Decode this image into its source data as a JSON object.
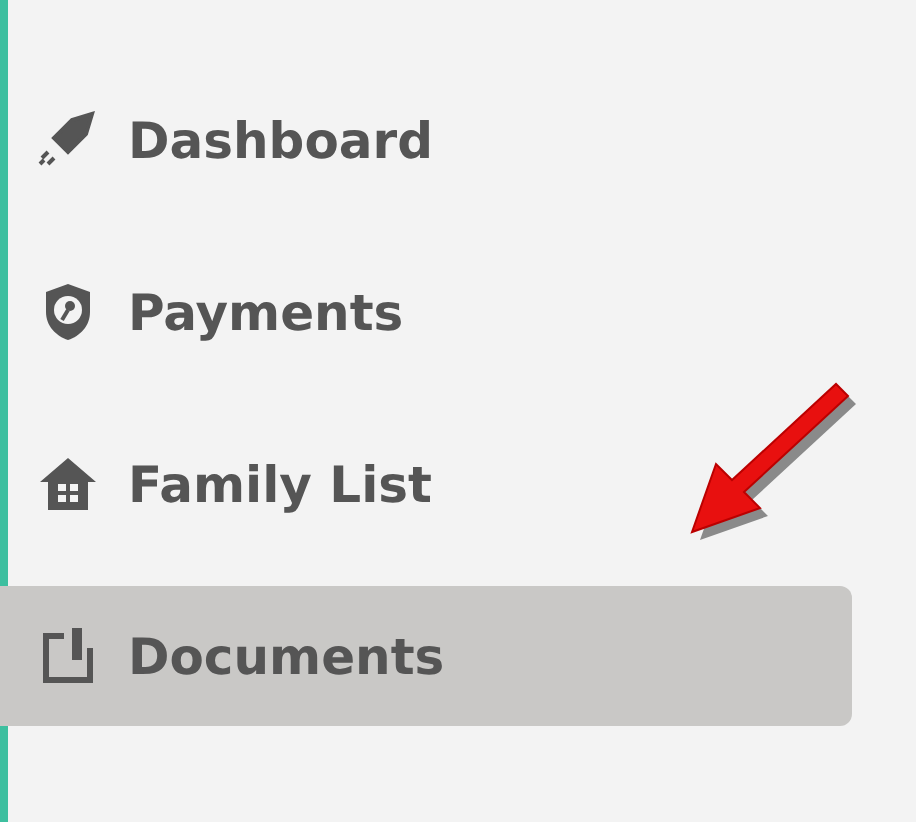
{
  "sidebar": {
    "items": [
      {
        "label": "Dashboard",
        "selected": false
      },
      {
        "label": "Payments",
        "selected": false
      },
      {
        "label": "Family List",
        "selected": false
      },
      {
        "label": "Documents",
        "selected": true
      }
    ]
  }
}
